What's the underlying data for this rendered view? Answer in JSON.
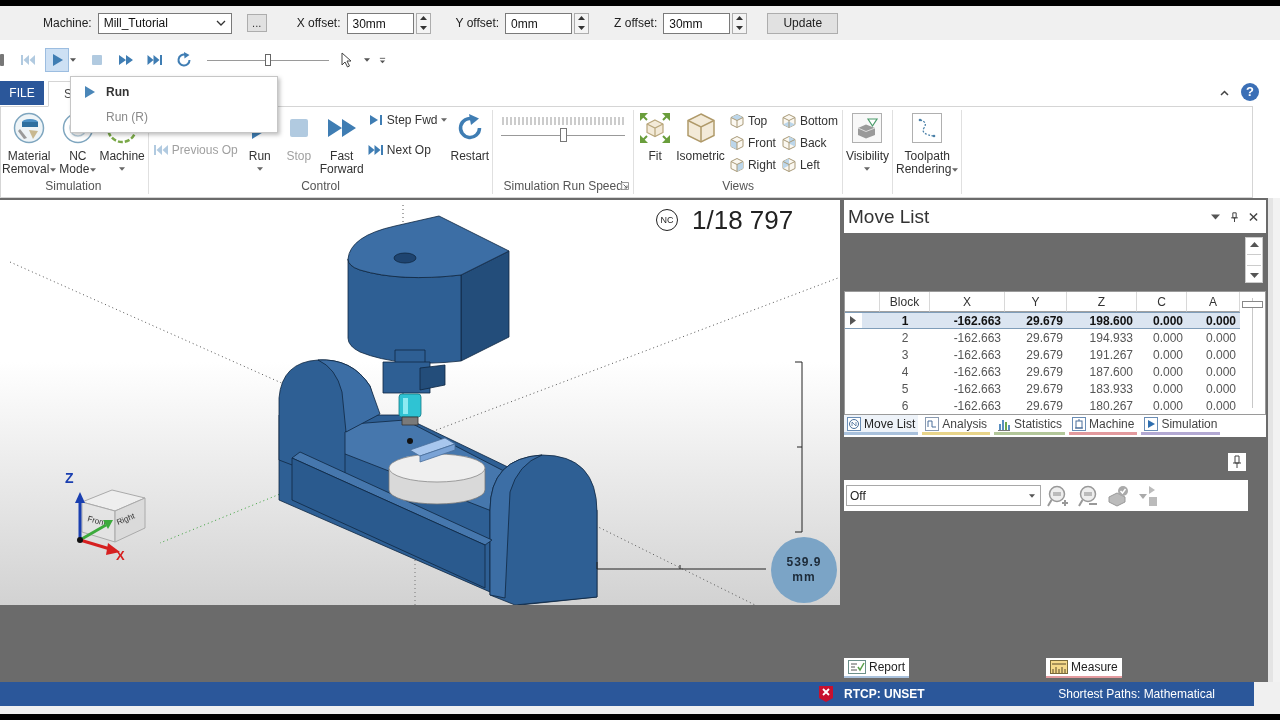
{
  "machine_bar": {
    "machine_label": "Machine:",
    "machine": "Mill_Tutorial",
    "browse": "...",
    "offsets": [
      {
        "label": "X offset:",
        "value": "30mm"
      },
      {
        "label": "Y offset:",
        "value": "0mm"
      },
      {
        "label": "Z offset:",
        "value": "30mm"
      }
    ],
    "update": "Update"
  },
  "quick_access": {
    "buttons": [
      {
        "disabled": true,
        "pressed": false
      },
      {
        "disabled": false,
        "pressed": true
      },
      {
        "disabled": true,
        "pressed": false
      },
      {
        "disabled": false,
        "pressed": false
      },
      {
        "disabled": false,
        "pressed": false
      },
      {
        "disabled": false,
        "pressed": false
      }
    ],
    "speed": {
      "level": 0.5
    }
  },
  "ribbon": {
    "tabs": [
      {
        "label": "FILE",
        "kind": "file",
        "selected": false
      },
      {
        "label": "S",
        "kind": "tab",
        "selected": true
      }
    ],
    "help": "?",
    "groups": [
      {
        "label": "Simulation",
        "items": [
          {
            "kind": "large",
            "lines": [
              "Material",
              "Removal"
            ],
            "dropdown": true,
            "disabled": false
          },
          {
            "kind": "large",
            "lines": [
              "NC",
              "Mode"
            ],
            "dropdown": true,
            "disabled": false
          },
          {
            "kind": "large",
            "lines": [
              "Machine"
            ],
            "dropdown": true,
            "disabled": false
          }
        ]
      },
      {
        "label": "Control",
        "items": [
          {
            "kind": "stack",
            "items": [
              {
                "label": "Previous Op",
                "dropdown": false,
                "disabled": true
              }
            ]
          },
          {
            "kind": "large",
            "lines": [
              "Run"
            ],
            "dropdown": true,
            "disabled": false
          },
          {
            "kind": "large",
            "lines": [
              "Stop"
            ],
            "dropdown": false,
            "disabled": true
          },
          {
            "kind": "large",
            "lines": [
              "Fast",
              "Forward"
            ],
            "dropdown": false,
            "disabled": false
          },
          {
            "kind": "stack",
            "items": [
              {
                "label": "Step Fwd",
                "dropdown": true,
                "disabled": false
              },
              {
                "label": "Next Op",
                "dropdown": false,
                "disabled": false
              }
            ]
          },
          {
            "kind": "large",
            "lines": [
              "Restart"
            ],
            "dropdown": false,
            "disabled": false
          }
        ]
      },
      {
        "label": "Simulation Run Speed",
        "launcher": true,
        "items": [
          {
            "kind": "slider",
            "level": 0.5
          }
        ]
      },
      {
        "label": "Views",
        "items": [
          {
            "kind": "large",
            "lines": [
              "Fit"
            ],
            "dropdown": false,
            "disabled": false
          },
          {
            "kind": "large",
            "lines": [
              "Isometric"
            ],
            "dropdown": false,
            "disabled": false
          },
          {
            "kind": "stack",
            "items": [
              {
                "label": "Top",
                "dropdown": false,
                "disabled": false
              },
              {
                "label": "Front",
                "dropdown": false,
                "disabled": false
              },
              {
                "label": "Right",
                "dropdown": false,
                "disabled": false
              }
            ]
          },
          {
            "kind": "stack",
            "items": [
              {
                "label": "Bottom",
                "dropdown": false,
                "disabled": false
              },
              {
                "label": "Back",
                "dropdown": false,
                "disabled": false
              },
              {
                "label": "Left",
                "dropdown": false,
                "disabled": false
              }
            ]
          }
        ]
      },
      {
        "items": [
          {
            "kind": "large",
            "lines": [
              "Visibility"
            ],
            "dropdown": true,
            "disabled": false
          }
        ]
      },
      {
        "items": [
          {
            "kind": "large",
            "lines": [
              "Toolpath",
              "Rendering"
            ],
            "dropdown": true,
            "disabled": false
          }
        ]
      }
    ]
  },
  "run_menu": {
    "items": [
      {
        "label": "Run",
        "default": true,
        "disabled": false
      },
      {
        "label": "Run (R)",
        "default": false,
        "disabled": true
      }
    ]
  },
  "viewport": {
    "nc_badge": "NC",
    "counter": "1/18 797",
    "scale": {
      "value": "539.9",
      "unit": "mm"
    },
    "axes": {
      "z": "Z",
      "x": "X"
    },
    "cube_faces": [
      "Front",
      "Right"
    ]
  },
  "move_list": {
    "title": "Move List",
    "table": {
      "columns": [
        "Block",
        "X",
        "Y",
        "Z",
        "C",
        "A"
      ],
      "rows": [
        {
          "cells": [
            "1",
            "-162.663",
            "29.679",
            "198.600",
            "0.000",
            "0.000"
          ],
          "selected": true
        },
        {
          "cells": [
            "2",
            "-162.663",
            "29.679",
            "194.933",
            "0.000",
            "0.000"
          ],
          "selected": false
        },
        {
          "cells": [
            "3",
            "-162.663",
            "29.679",
            "191.267",
            "0.000",
            "0.000"
          ],
          "selected": false
        },
        {
          "cells": [
            "4",
            "-162.663",
            "29.679",
            "187.600",
            "0.000",
            "0.000"
          ],
          "selected": false
        },
        {
          "cells": [
            "5",
            "-162.663",
            "29.679",
            "183.933",
            "0.000",
            "0.000"
          ],
          "selected": false
        },
        {
          "cells": [
            "6",
            "-162.663",
            "29.679",
            "180.267",
            "0.000",
            "0.000"
          ],
          "selected": false
        }
      ]
    },
    "tabs": [
      {
        "label": "Move List",
        "selected": true,
        "color": "#a9c1dc"
      },
      {
        "label": "Analysis",
        "selected": false,
        "color": "#e9d58a"
      },
      {
        "label": "Statistics",
        "selected": false,
        "color": "#b3c79a"
      },
      {
        "label": "Machine",
        "selected": false,
        "color": "#e39a9e"
      },
      {
        "label": "Simulation",
        "selected": false,
        "color": "#b3a9d3"
      }
    ],
    "filter": {
      "value": "Off"
    }
  },
  "bottom_tabs": [
    {
      "label": "Report",
      "selected": false,
      "color": "#a9c1dc"
    },
    {
      "label": "Measure",
      "selected": false,
      "color": "#e39a9e"
    }
  ],
  "status_bar": {
    "rtcp": "RTCP: UNSET",
    "paths": "Shortest Paths: Mathematical"
  }
}
